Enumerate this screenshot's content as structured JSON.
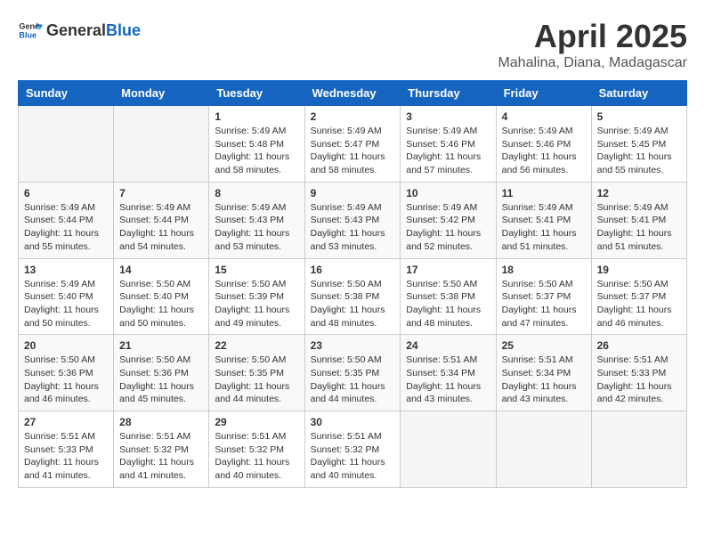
{
  "header": {
    "logo_general": "General",
    "logo_blue": "Blue",
    "month_title": "April 2025",
    "subtitle": "Mahalina, Diana, Madagascar"
  },
  "calendar": {
    "days_of_week": [
      "Sunday",
      "Monday",
      "Tuesday",
      "Wednesday",
      "Thursday",
      "Friday",
      "Saturday"
    ],
    "weeks": [
      [
        {
          "day": "",
          "info": ""
        },
        {
          "day": "",
          "info": ""
        },
        {
          "day": "1",
          "info": "Sunrise: 5:49 AM\nSunset: 5:48 PM\nDaylight: 11 hours and 58 minutes."
        },
        {
          "day": "2",
          "info": "Sunrise: 5:49 AM\nSunset: 5:47 PM\nDaylight: 11 hours and 58 minutes."
        },
        {
          "day": "3",
          "info": "Sunrise: 5:49 AM\nSunset: 5:46 PM\nDaylight: 11 hours and 57 minutes."
        },
        {
          "day": "4",
          "info": "Sunrise: 5:49 AM\nSunset: 5:46 PM\nDaylight: 11 hours and 56 minutes."
        },
        {
          "day": "5",
          "info": "Sunrise: 5:49 AM\nSunset: 5:45 PM\nDaylight: 11 hours and 55 minutes."
        }
      ],
      [
        {
          "day": "6",
          "info": "Sunrise: 5:49 AM\nSunset: 5:44 PM\nDaylight: 11 hours and 55 minutes."
        },
        {
          "day": "7",
          "info": "Sunrise: 5:49 AM\nSunset: 5:44 PM\nDaylight: 11 hours and 54 minutes."
        },
        {
          "day": "8",
          "info": "Sunrise: 5:49 AM\nSunset: 5:43 PM\nDaylight: 11 hours and 53 minutes."
        },
        {
          "day": "9",
          "info": "Sunrise: 5:49 AM\nSunset: 5:43 PM\nDaylight: 11 hours and 53 minutes."
        },
        {
          "day": "10",
          "info": "Sunrise: 5:49 AM\nSunset: 5:42 PM\nDaylight: 11 hours and 52 minutes."
        },
        {
          "day": "11",
          "info": "Sunrise: 5:49 AM\nSunset: 5:41 PM\nDaylight: 11 hours and 51 minutes."
        },
        {
          "day": "12",
          "info": "Sunrise: 5:49 AM\nSunset: 5:41 PM\nDaylight: 11 hours and 51 minutes."
        }
      ],
      [
        {
          "day": "13",
          "info": "Sunrise: 5:49 AM\nSunset: 5:40 PM\nDaylight: 11 hours and 50 minutes."
        },
        {
          "day": "14",
          "info": "Sunrise: 5:50 AM\nSunset: 5:40 PM\nDaylight: 11 hours and 50 minutes."
        },
        {
          "day": "15",
          "info": "Sunrise: 5:50 AM\nSunset: 5:39 PM\nDaylight: 11 hours and 49 minutes."
        },
        {
          "day": "16",
          "info": "Sunrise: 5:50 AM\nSunset: 5:38 PM\nDaylight: 11 hours and 48 minutes."
        },
        {
          "day": "17",
          "info": "Sunrise: 5:50 AM\nSunset: 5:38 PM\nDaylight: 11 hours and 48 minutes."
        },
        {
          "day": "18",
          "info": "Sunrise: 5:50 AM\nSunset: 5:37 PM\nDaylight: 11 hours and 47 minutes."
        },
        {
          "day": "19",
          "info": "Sunrise: 5:50 AM\nSunset: 5:37 PM\nDaylight: 11 hours and 46 minutes."
        }
      ],
      [
        {
          "day": "20",
          "info": "Sunrise: 5:50 AM\nSunset: 5:36 PM\nDaylight: 11 hours and 46 minutes."
        },
        {
          "day": "21",
          "info": "Sunrise: 5:50 AM\nSunset: 5:36 PM\nDaylight: 11 hours and 45 minutes."
        },
        {
          "day": "22",
          "info": "Sunrise: 5:50 AM\nSunset: 5:35 PM\nDaylight: 11 hours and 44 minutes."
        },
        {
          "day": "23",
          "info": "Sunrise: 5:50 AM\nSunset: 5:35 PM\nDaylight: 11 hours and 44 minutes."
        },
        {
          "day": "24",
          "info": "Sunrise: 5:51 AM\nSunset: 5:34 PM\nDaylight: 11 hours and 43 minutes."
        },
        {
          "day": "25",
          "info": "Sunrise: 5:51 AM\nSunset: 5:34 PM\nDaylight: 11 hours and 43 minutes."
        },
        {
          "day": "26",
          "info": "Sunrise: 5:51 AM\nSunset: 5:33 PM\nDaylight: 11 hours and 42 minutes."
        }
      ],
      [
        {
          "day": "27",
          "info": "Sunrise: 5:51 AM\nSunset: 5:33 PM\nDaylight: 11 hours and 41 minutes."
        },
        {
          "day": "28",
          "info": "Sunrise: 5:51 AM\nSunset: 5:32 PM\nDaylight: 11 hours and 41 minutes."
        },
        {
          "day": "29",
          "info": "Sunrise: 5:51 AM\nSunset: 5:32 PM\nDaylight: 11 hours and 40 minutes."
        },
        {
          "day": "30",
          "info": "Sunrise: 5:51 AM\nSunset: 5:32 PM\nDaylight: 11 hours and 40 minutes."
        },
        {
          "day": "",
          "info": ""
        },
        {
          "day": "",
          "info": ""
        },
        {
          "day": "",
          "info": ""
        }
      ]
    ]
  }
}
